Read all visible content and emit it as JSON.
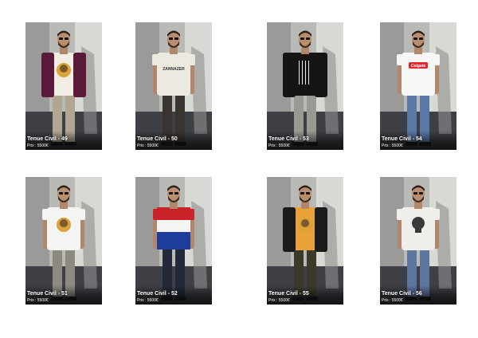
{
  "outfits": [
    {
      "title": "Tenue Civil - 49",
      "price": "Prix : 5500€",
      "shirt": "#f1ede2",
      "jacket": "#5a1a3a",
      "pants": "#b0a692",
      "emblem": "cat"
    },
    {
      "title": "Tenue Civil - 50",
      "price": "Prix : 5500€",
      "shirt": "#ece9e1",
      "jacket": "",
      "pants": "#3a3430",
      "emblem": "text",
      "emblem_text": "ZANNAZER"
    },
    {
      "title": "Tenue Civil - 53",
      "price": "Prix : 5500€",
      "shirt": "#151515",
      "jacket": "#151515",
      "pants": "#9a9a92",
      "emblem": "lines"
    },
    {
      "title": "Tenue Civil - 54",
      "price": "Prix : 5500€",
      "shirt": "#f6f6f6",
      "jacket": "",
      "pants": "#5a78a6",
      "emblem": "logo",
      "emblem_text": "Colgate"
    },
    {
      "title": "Tenue Civil - 51",
      "price": "Prix : 5500€",
      "shirt": "#f4f4f2",
      "jacket": "",
      "pants": "#8c8a80",
      "emblem": "cat"
    },
    {
      "title": "Tenue Civil - 52",
      "price": "Prix : 5500€",
      "shirt": "flag",
      "jacket": "",
      "pants": "#222a3a",
      "emblem": ""
    },
    {
      "title": "Tenue Civil - 55",
      "price": "Prix : 5500€",
      "shirt": "#e9a23a",
      "jacket": "#1a1a1a",
      "pants": "#3b3a2a",
      "emblem": "cat"
    },
    {
      "title": "Tenue Civil - 56",
      "price": "Prix : 5500€",
      "shirt": "#f0efec",
      "jacket": "",
      "pants": "#5d76a0",
      "emblem": "skull"
    }
  ]
}
